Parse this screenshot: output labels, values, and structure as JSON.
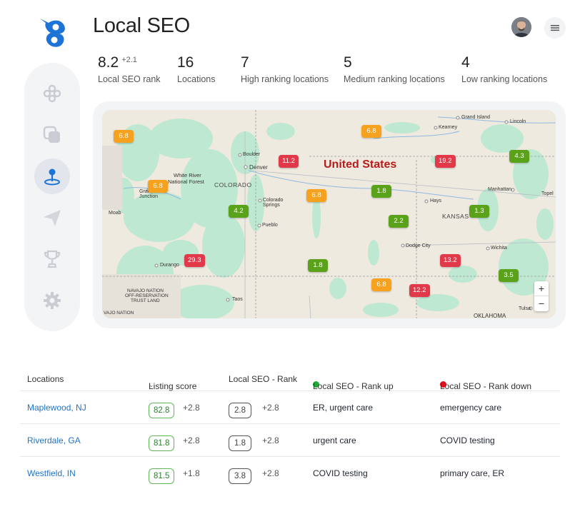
{
  "header": {
    "title": "Local SEO"
  },
  "stats": [
    {
      "value": "8.2",
      "delta": "+2.1",
      "label": "Local SEO rank"
    },
    {
      "value": "16",
      "delta": "",
      "label": "Locations"
    },
    {
      "value": "7",
      "delta": "",
      "label": "High ranking locations"
    },
    {
      "value": "5",
      "delta": "",
      "label": "Medium ranking locations"
    },
    {
      "value": "4",
      "delta": "",
      "label": "Low ranking locations"
    }
  ],
  "map": {
    "country": "United States",
    "states": [
      "COLORADO",
      "KANSAS",
      "NAVAJO NATION",
      "OFF-RESERVATION",
      "TRUST LAND",
      "VAJO NATION",
      "OKLAHOMA"
    ],
    "cities": [
      "Grand Island",
      "Kearney",
      "Lincoln",
      "Boulder",
      "Denver",
      "White River",
      "National Forest",
      "Grand",
      "Junction",
      "Colorado",
      "Springs",
      "Moab",
      "Pueblo",
      "Hays",
      "Manhattan",
      "Topel",
      "Dodge City",
      "Wichita",
      "Durango",
      "Taos",
      "Tulsa"
    ],
    "pins": [
      "6.8",
      "6.8",
      "11.2",
      "19.2",
      "4.3",
      "6.8",
      "6.8",
      "1.8",
      "1.3",
      "4.2",
      "2.2",
      "29.3",
      "1.8",
      "13.2",
      "3.5",
      "6.8",
      "12.2"
    ],
    "zoom_in": "+",
    "zoom_out": "−"
  },
  "table": {
    "headers": {
      "locations": "Locations",
      "listing_score": "Listing score",
      "sort_icon": "⌄",
      "rank": "Local SEO - Rank",
      "rank_up": "Local SEO - Rank up",
      "rank_down": "Local SEO - Rank down"
    },
    "rows": [
      {
        "location": "Maplewood, NJ",
        "score": "82.8",
        "score_delta": "+2.8",
        "rank": "2.8",
        "rank_delta": "+2.8",
        "up": "ER, urgent care",
        "down": "emergency care"
      },
      {
        "location": "Riverdale, GA",
        "score": "81.8",
        "score_delta": "+2.8",
        "rank": "1.8",
        "rank_delta": "+2.8",
        "up": "urgent care",
        "down": "COVID testing"
      },
      {
        "location": "Westfield, IN",
        "score": "81.5",
        "score_delta": "+1.8",
        "rank": "3.8",
        "rank_delta": "+2.8",
        "up": "COVID testing",
        "down": "primary care, ER"
      }
    ]
  },
  "colors": {
    "accent": "#1e73d6",
    "high": "#e2394a",
    "medium": "#f6a21e",
    "low": "#5aa21a",
    "rank_up_dot": "#22a63c",
    "rank_down_dot": "#e0141b"
  },
  "icons": {
    "sidebar": [
      "dashboard-icon",
      "layers-icon",
      "location-pin-icon",
      "send-icon",
      "trophy-icon",
      "gear-icon"
    ],
    "menu": "hamburger-icon"
  }
}
